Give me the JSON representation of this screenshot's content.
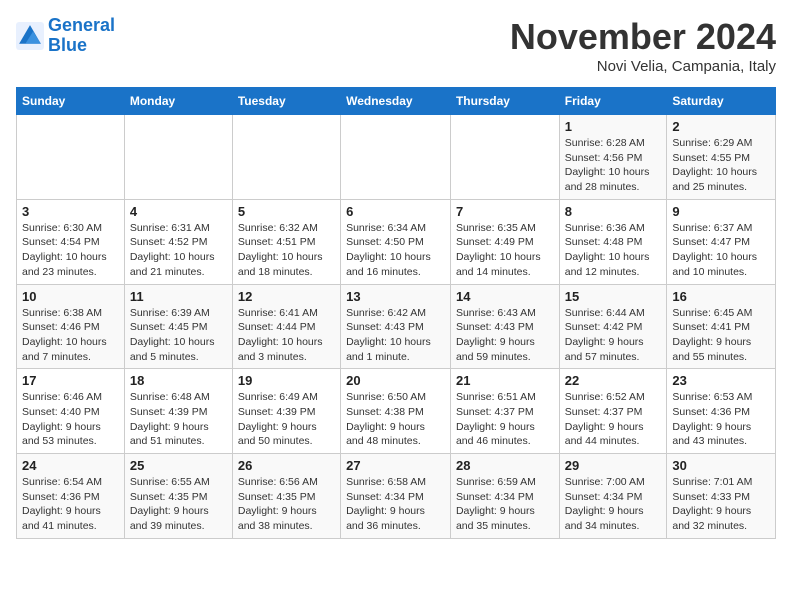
{
  "header": {
    "logo_line1": "General",
    "logo_line2": "Blue",
    "month": "November 2024",
    "location": "Novi Velia, Campania, Italy"
  },
  "days_of_week": [
    "Sunday",
    "Monday",
    "Tuesday",
    "Wednesday",
    "Thursday",
    "Friday",
    "Saturday"
  ],
  "weeks": [
    [
      {
        "day": "",
        "info": ""
      },
      {
        "day": "",
        "info": ""
      },
      {
        "day": "",
        "info": ""
      },
      {
        "day": "",
        "info": ""
      },
      {
        "day": "",
        "info": ""
      },
      {
        "day": "1",
        "info": "Sunrise: 6:28 AM\nSunset: 4:56 PM\nDaylight: 10 hours and 28 minutes."
      },
      {
        "day": "2",
        "info": "Sunrise: 6:29 AM\nSunset: 4:55 PM\nDaylight: 10 hours and 25 minutes."
      }
    ],
    [
      {
        "day": "3",
        "info": "Sunrise: 6:30 AM\nSunset: 4:54 PM\nDaylight: 10 hours and 23 minutes."
      },
      {
        "day": "4",
        "info": "Sunrise: 6:31 AM\nSunset: 4:52 PM\nDaylight: 10 hours and 21 minutes."
      },
      {
        "day": "5",
        "info": "Sunrise: 6:32 AM\nSunset: 4:51 PM\nDaylight: 10 hours and 18 minutes."
      },
      {
        "day": "6",
        "info": "Sunrise: 6:34 AM\nSunset: 4:50 PM\nDaylight: 10 hours and 16 minutes."
      },
      {
        "day": "7",
        "info": "Sunrise: 6:35 AM\nSunset: 4:49 PM\nDaylight: 10 hours and 14 minutes."
      },
      {
        "day": "8",
        "info": "Sunrise: 6:36 AM\nSunset: 4:48 PM\nDaylight: 10 hours and 12 minutes."
      },
      {
        "day": "9",
        "info": "Sunrise: 6:37 AM\nSunset: 4:47 PM\nDaylight: 10 hours and 10 minutes."
      }
    ],
    [
      {
        "day": "10",
        "info": "Sunrise: 6:38 AM\nSunset: 4:46 PM\nDaylight: 10 hours and 7 minutes."
      },
      {
        "day": "11",
        "info": "Sunrise: 6:39 AM\nSunset: 4:45 PM\nDaylight: 10 hours and 5 minutes."
      },
      {
        "day": "12",
        "info": "Sunrise: 6:41 AM\nSunset: 4:44 PM\nDaylight: 10 hours and 3 minutes."
      },
      {
        "day": "13",
        "info": "Sunrise: 6:42 AM\nSunset: 4:43 PM\nDaylight: 10 hours and 1 minute."
      },
      {
        "day": "14",
        "info": "Sunrise: 6:43 AM\nSunset: 4:43 PM\nDaylight: 9 hours and 59 minutes."
      },
      {
        "day": "15",
        "info": "Sunrise: 6:44 AM\nSunset: 4:42 PM\nDaylight: 9 hours and 57 minutes."
      },
      {
        "day": "16",
        "info": "Sunrise: 6:45 AM\nSunset: 4:41 PM\nDaylight: 9 hours and 55 minutes."
      }
    ],
    [
      {
        "day": "17",
        "info": "Sunrise: 6:46 AM\nSunset: 4:40 PM\nDaylight: 9 hours and 53 minutes."
      },
      {
        "day": "18",
        "info": "Sunrise: 6:48 AM\nSunset: 4:39 PM\nDaylight: 9 hours and 51 minutes."
      },
      {
        "day": "19",
        "info": "Sunrise: 6:49 AM\nSunset: 4:39 PM\nDaylight: 9 hours and 50 minutes."
      },
      {
        "day": "20",
        "info": "Sunrise: 6:50 AM\nSunset: 4:38 PM\nDaylight: 9 hours and 48 minutes."
      },
      {
        "day": "21",
        "info": "Sunrise: 6:51 AM\nSunset: 4:37 PM\nDaylight: 9 hours and 46 minutes."
      },
      {
        "day": "22",
        "info": "Sunrise: 6:52 AM\nSunset: 4:37 PM\nDaylight: 9 hours and 44 minutes."
      },
      {
        "day": "23",
        "info": "Sunrise: 6:53 AM\nSunset: 4:36 PM\nDaylight: 9 hours and 43 minutes."
      }
    ],
    [
      {
        "day": "24",
        "info": "Sunrise: 6:54 AM\nSunset: 4:36 PM\nDaylight: 9 hours and 41 minutes."
      },
      {
        "day": "25",
        "info": "Sunrise: 6:55 AM\nSunset: 4:35 PM\nDaylight: 9 hours and 39 minutes."
      },
      {
        "day": "26",
        "info": "Sunrise: 6:56 AM\nSunset: 4:35 PM\nDaylight: 9 hours and 38 minutes."
      },
      {
        "day": "27",
        "info": "Sunrise: 6:58 AM\nSunset: 4:34 PM\nDaylight: 9 hours and 36 minutes."
      },
      {
        "day": "28",
        "info": "Sunrise: 6:59 AM\nSunset: 4:34 PM\nDaylight: 9 hours and 35 minutes."
      },
      {
        "day": "29",
        "info": "Sunrise: 7:00 AM\nSunset: 4:34 PM\nDaylight: 9 hours and 34 minutes."
      },
      {
        "day": "30",
        "info": "Sunrise: 7:01 AM\nSunset: 4:33 PM\nDaylight: 9 hours and 32 minutes."
      }
    ]
  ]
}
